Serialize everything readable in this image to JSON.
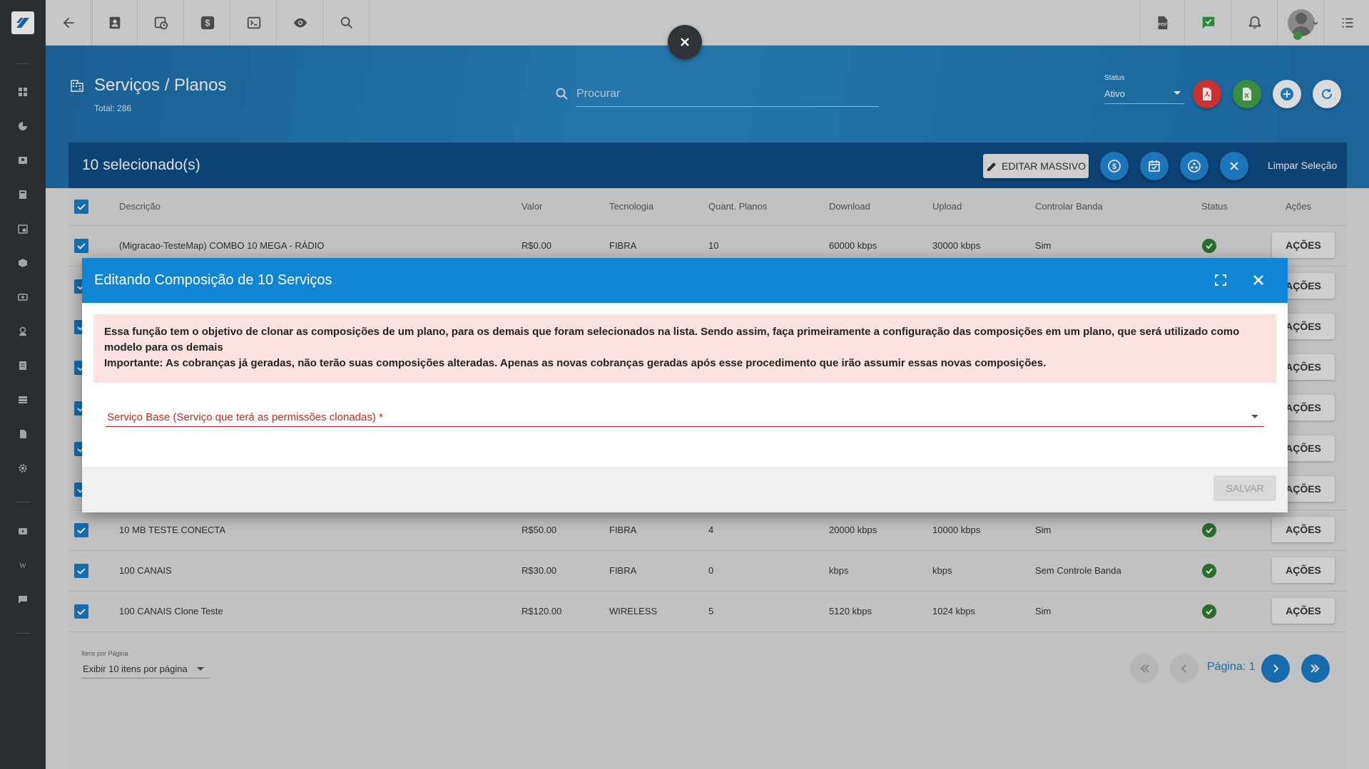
{
  "header": {
    "title": "Serviços / Planos",
    "total": "Total: 286",
    "search_placeholder": "Procurar",
    "status_label": "Status",
    "status_value": "Ativo"
  },
  "selection": {
    "count": "10 selecionado(s)",
    "edit_mass": "EDITAR MASSIVO",
    "clear": "Limpar Seleção"
  },
  "table": {
    "columns": [
      "Descrição",
      "Valor",
      "Tecnologia",
      "Quant. Planos",
      "Download",
      "Upload",
      "Controlar Banda",
      "Status",
      "Ações"
    ],
    "action_label": "AÇÕES",
    "rows": [
      {
        "descricao": "(Migracao-TesteMap) COMBO 10 MEGA - RÁDIO",
        "valor": "R$0.00",
        "tecnologia": "FIBRA",
        "quant": "10",
        "download": "60000 kbps",
        "upload": "30000 kbps",
        "banda": "Sim"
      },
      {
        "descricao": "10 MB TESTE CONECTA",
        "valor": "R$50.00",
        "tecnologia": "FIBRA",
        "quant": "4",
        "download": "20000 kbps",
        "upload": "10000 kbps",
        "banda": "Sim"
      },
      {
        "descricao": "100 CANAIS",
        "valor": "R$30.00",
        "tecnologia": "FIBRA",
        "quant": "0",
        "download": "kbps",
        "upload": "kbps",
        "banda": "Sem Controle Banda"
      },
      {
        "descricao": "100 CANAIS Clone Teste",
        "valor": "R$120.00",
        "tecnologia": "WIRELESS",
        "quant": "5",
        "download": "5120 kbps",
        "upload": "1024 kbps",
        "banda": "Sim"
      }
    ]
  },
  "pagination": {
    "items_label": "Itens por Página",
    "items_value": "Exibir 10 itens por página",
    "page_label": "Página: 1"
  },
  "modal": {
    "title": "Editando Composição de 10 Serviços",
    "alert_line1": "Essa função tem o objetivo de clonar as composições de um plano, para os demais que foram selecionados na lista. Sendo assim, faça primeiramente a configuração das composições em um plano, que será utilizado como modelo para os demais",
    "alert_line2": "Importante: As cobranças já geradas, não terão suas composições alteradas. Apenas as novas cobranças geradas após esse procedimento que irão assumir essas novas composições.",
    "field_label": "Serviço Base (Serviço que terá as permissões clonadas) *",
    "save": "SALVAR"
  },
  "colors": {
    "sidebar": "#2f3438",
    "header_blue": "#2a86c4",
    "selection_bar": "#0e4c85",
    "modal_header": "#0f85d3",
    "checkbox": "#1a7cc4",
    "status_ok": "#2e7d32",
    "alert_bg": "#fde2e2",
    "error_red": "#c62828"
  },
  "icons": {
    "topbar": [
      "back-arrow-icon",
      "contact-card-icon",
      "clock-calendar-icon",
      "dollar-icon",
      "terminal-icon",
      "eye-icon",
      "search-icon",
      "pdf-icon",
      "check-chat-icon",
      "bell-icon",
      "avatar",
      "list-icon"
    ],
    "sidebar": [
      "dashboard-icon",
      "chart-icon",
      "person-card-icon",
      "book-icon",
      "calendar-icon",
      "box-icon",
      "money-icon",
      "user-pin-icon",
      "document-icon",
      "stack-icon",
      "file-icon",
      "gear-icon",
      "video-icon",
      "wiki-icon",
      "chat-icon"
    ]
  }
}
